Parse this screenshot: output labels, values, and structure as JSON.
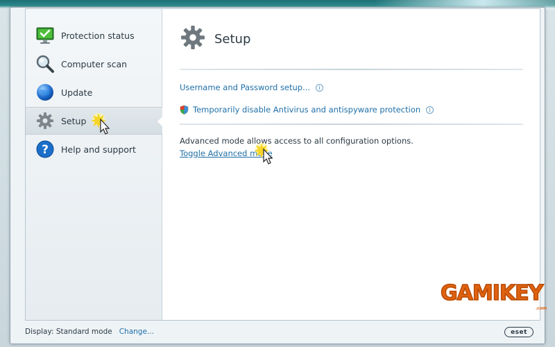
{
  "sidebar": {
    "items": [
      {
        "label": "Protection status",
        "icon": "monitor-check-icon"
      },
      {
        "label": "Computer scan",
        "icon": "magnifier-icon"
      },
      {
        "label": "Update",
        "icon": "globe-icon"
      },
      {
        "label": "Setup",
        "icon": "gear-icon",
        "active": true
      },
      {
        "label": "Help and support",
        "icon": "help-icon"
      }
    ]
  },
  "main": {
    "title": "Setup",
    "links": [
      {
        "label": "Username and Password setup..."
      },
      {
        "label": "Temporarily disable Antivirus and antispyware protection"
      }
    ],
    "advanced_desc": "Advanced mode allows access to all configuration options.",
    "toggle_label": "Toggle Advanced mode"
  },
  "status": {
    "display_label": "Display: Standard mode",
    "change_label": "Change...",
    "logo": "eset"
  },
  "watermark": {
    "text": "GAMIKEY",
    "sub": ".com"
  },
  "colors": {
    "link": "#1f6fa8",
    "text": "#2b3a44",
    "brand_watermark": "#e0620f"
  }
}
